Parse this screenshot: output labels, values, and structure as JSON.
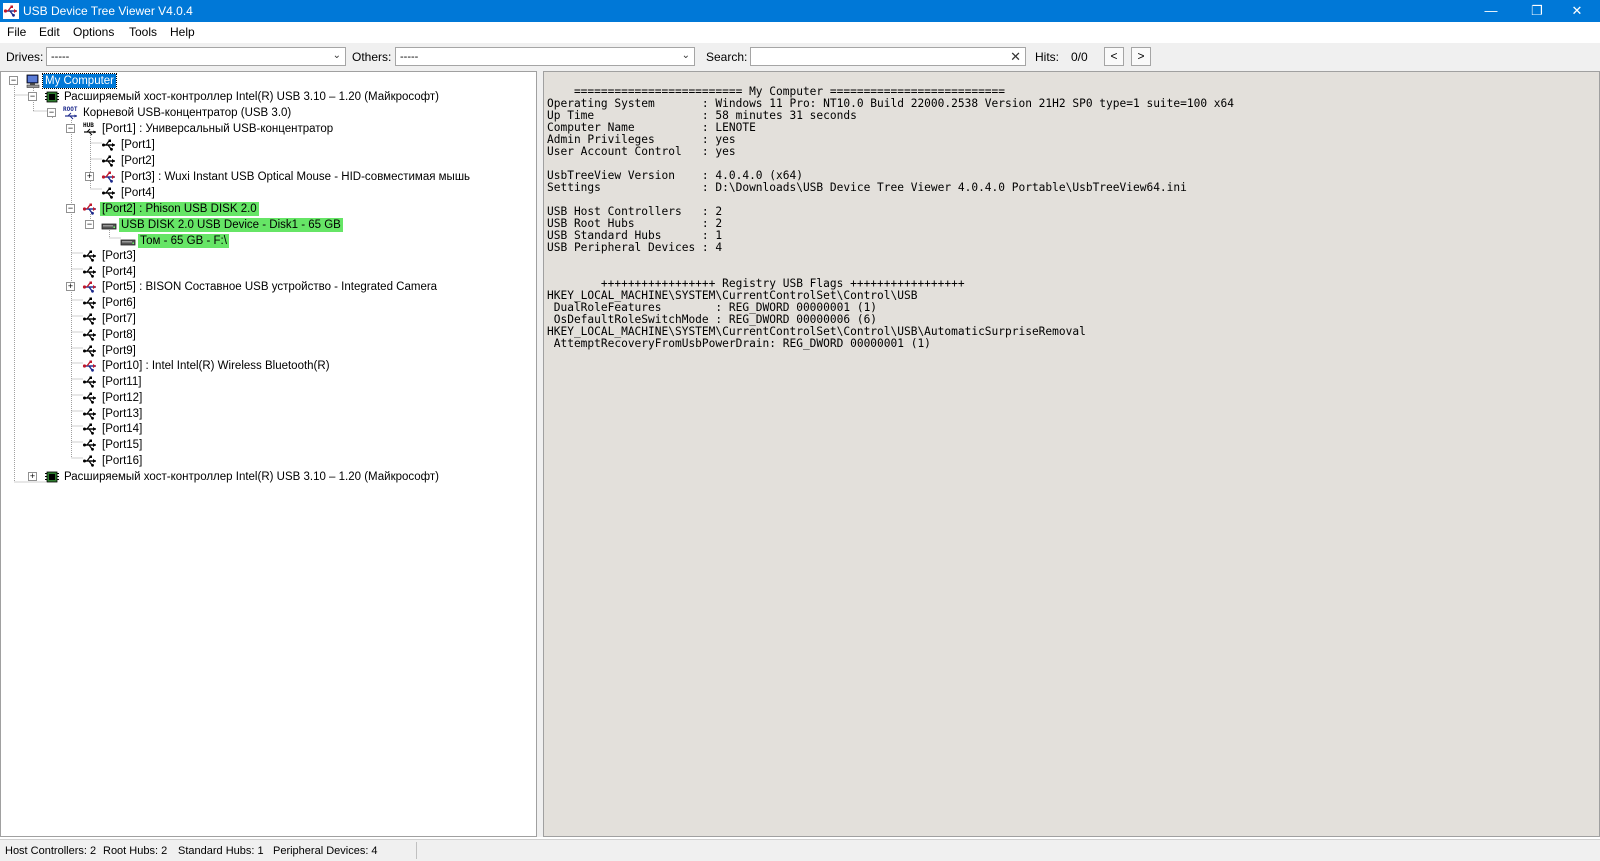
{
  "window": {
    "title": "USB Device Tree Viewer V4.0.4",
    "minimize_glyph": "—",
    "restore_glyph": "❐",
    "close_glyph": "✕"
  },
  "menu": [
    "File",
    "Edit",
    "Options",
    "Tools",
    "Help"
  ],
  "toolbar": {
    "drives_label": "Drives:",
    "drives_value": "-----",
    "others_label": "Others:",
    "others_value": "-----",
    "search_label": "Search:",
    "search_value": "",
    "hits_label": "Hits:",
    "hits_value": "0/0",
    "prev_glyph": "<",
    "next_glyph": ">"
  },
  "tree": {
    "root_label": "My Computer",
    "controller1_label": "Расширяемый хост-контроллер Intel(R) USB 3.10 – 1.20 (Майкрософт)",
    "root_hub_label": "Корневой USB-концентратор (USB 3.0)",
    "port1_hub_label": "[Port1] : Универсальный USB-концентратор",
    "sub_port1": "[Port1]",
    "sub_port2": "[Port2]",
    "sub_port3": "[Port3] : Wuxi Instant USB Optical Mouse - HID-совместимая мышь",
    "sub_port4": "[Port4]",
    "port2_label": "[Port2] : Phison USB DISK 2.0",
    "disk_label": "USB DISK 2.0 USB Device - Disk1 - 65 GB",
    "volume_label": "Том - 65 GB - F:\\",
    "port3": "[Port3]",
    "port4": "[Port4]",
    "port5": "[Port5] : BISON Составное USB устройство - Integrated Camera",
    "port6": "[Port6]",
    "port7": "[Port7]",
    "port8": "[Port8]",
    "port9": "[Port9]",
    "port10": "[Port10] : Intel Intel(R) Wireless Bluetooth(R)",
    "port11": "[Port11]",
    "port12": "[Port12]",
    "port13": "[Port13]",
    "port14": "[Port14]",
    "port15": "[Port15]",
    "port16": "[Port16]",
    "controller2_label": "Расширяемый хост-контроллер Intel(R) USB 3.10 – 1.20 (Майкрософт)"
  },
  "info_text": "    ========================= My Computer ==========================\nOperating System       : Windows 11 Pro: NT10.0 Build 22000.2538 Version 21H2 SP0 type=1 suite=100 x64\nUp Time                : 58 minutes 31 seconds\nComputer Name          : LENOTE\nAdmin Privileges       : yes\nUser Account Control   : yes\n\nUsbTreeView Version    : 4.0.4.0 (x64)\nSettings               : D:\\Downloads\\USB Device Tree Viewer 4.0.4.0 Portable\\UsbTreeView64.ini\n\nUSB Host Controllers   : 2\nUSB Root Hubs          : 2\nUSB Standard Hubs      : 1\nUSB Peripheral Devices : 4\n\n\n        +++++++++++++++++ Registry USB Flags +++++++++++++++++\nHKEY_LOCAL_MACHINE\\SYSTEM\\CurrentControlSet\\Control\\USB\n DualRoleFeatures        : REG_DWORD 00000001 (1)\n OsDefaultRoleSwitchMode : REG_DWORD 00000006 (6)\nHKEY_LOCAL_MACHINE\\SYSTEM\\CurrentControlSet\\Control\\USB\\AutomaticSurpriseRemoval\n AttemptRecoveryFromUsbPowerDrain: REG_DWORD 00000001 (1)",
  "status": {
    "host_controllers": "Host Controllers: 2",
    "root_hubs": "Root Hubs: 2",
    "standard_hubs": "Standard Hubs: 1",
    "peripheral_devices": "Peripheral Devices: 4"
  },
  "colors": {
    "titlebar": "#0078d7",
    "selection": "#0078d7",
    "highlight_green": "#66e566",
    "info_background": "#e3e0db"
  },
  "icons": {
    "app": "usb-app-icon",
    "computer": "computer-icon",
    "controller": "chip-icon",
    "root_hub": "root-hub-icon",
    "hub": "hub-icon",
    "usb_port": "usb-port-icon",
    "disk": "disk-icon",
    "volume": "volume-icon"
  }
}
